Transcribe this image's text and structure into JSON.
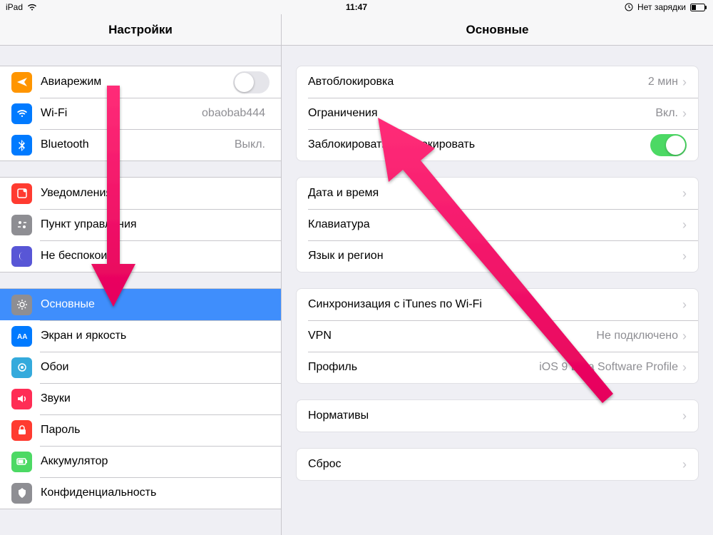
{
  "status": {
    "device": "iPad",
    "time": "11:47",
    "charge": "Нет зарядки"
  },
  "sidebar": {
    "title": "Настройки",
    "g1": {
      "airplane": "Авиарежим",
      "wifi": "Wi-Fi",
      "wifi_value": "obaobab444",
      "bt": "Bluetooth",
      "bt_value": "Выкл."
    },
    "g2": {
      "notif": "Уведомления",
      "control": "Пункт управления",
      "dnd": "Не беспокоить"
    },
    "g3": {
      "general": "Основные",
      "display": "Экран и яркость",
      "wallpaper": "Обои",
      "sounds": "Звуки",
      "passcode": "Пароль",
      "battery": "Аккумулятор",
      "privacy": "Конфиденциальность"
    }
  },
  "detail": {
    "title": "Основные",
    "g1": {
      "autolock": "Автоблокировка",
      "autolock_value": "2 мин",
      "restrictions": "Ограничения",
      "restrictions_value": "Вкл.",
      "lockunlock": "Заблокировать/разблокировать"
    },
    "g2": {
      "datetime": "Дата и время",
      "keyboard": "Клавиатура",
      "lang": "Язык и регион"
    },
    "g3": {
      "itunes": "Синхронизация с iTunes по Wi-Fi",
      "vpn": "VPN",
      "vpn_value": "Не подключено",
      "profile": "Профиль",
      "profile_value": "iOS 9 Beta Software Profile"
    },
    "g4": {
      "reg": "Нормативы"
    },
    "g5": {
      "reset": "Сброс"
    }
  }
}
